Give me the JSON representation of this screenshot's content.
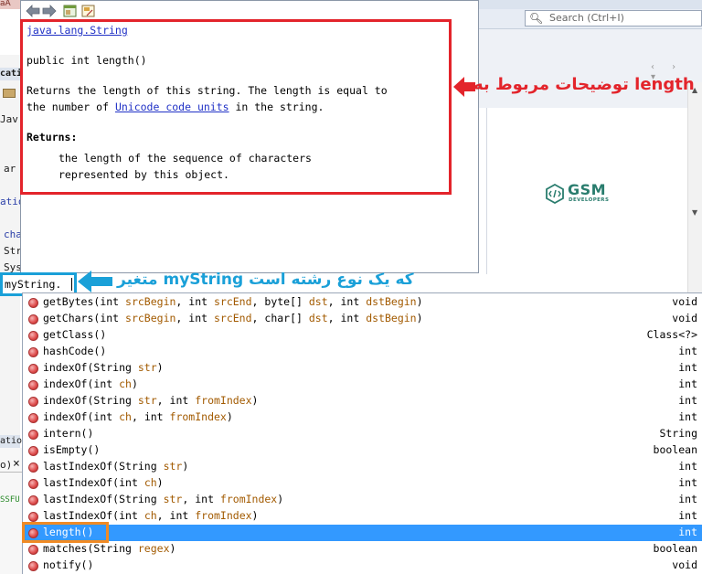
{
  "ide": {
    "title_fragment": "aA",
    "search_placeholder": "Search (Ctrl+I)",
    "left_fragments": [
      "cati",
      "Jav",
      "ar",
      "atio",
      "cha",
      "Str",
      "Sys",
      "ation",
      "o)",
      "SSFU"
    ],
    "logo_text": "GSM",
    "logo_subtext": "DEVELOPERS"
  },
  "doc_popup": {
    "class_link": "java.lang.String",
    "signature": "public int length()",
    "description_1": "Returns the length of this string. The length is equal to",
    "description_2a": "the number of ",
    "description_link": "Unicode code units",
    "description_2b": " in the string.",
    "returns_label": "Returns:",
    "returns_1": "the length of the sequence of characters",
    "returns_2": "represented by this object."
  },
  "annotations": {
    "red": "توضیحات مربوط به length",
    "blue": "متغیر myString که یک نوع رشته است"
  },
  "editor": {
    "input_text": "myString."
  },
  "completion": {
    "items": [
      {
        "name": "getBytes",
        "params": "(int srcBegin, int srcEnd, byte[] dst, int dstBegin)",
        "ret": "void",
        "selected": false
      },
      {
        "name": "getChars",
        "params": "(int srcBegin, int srcEnd, char[] dst, int dstBegin)",
        "ret": "void",
        "selected": false
      },
      {
        "name": "getClass",
        "params": "()",
        "ret": "Class<?>",
        "selected": false
      },
      {
        "name": "hashCode",
        "params": "()",
        "ret": "int",
        "selected": false
      },
      {
        "name": "indexOf",
        "params": "(String str)",
        "ret": "int",
        "selected": false
      },
      {
        "name": "indexOf",
        "params": "(int ch)",
        "ret": "int",
        "selected": false
      },
      {
        "name": "indexOf",
        "params": "(String str, int fromIndex)",
        "ret": "int",
        "selected": false
      },
      {
        "name": "indexOf",
        "params": "(int ch, int fromIndex)",
        "ret": "int",
        "selected": false
      },
      {
        "name": "intern",
        "params": "()",
        "ret": "String",
        "selected": false
      },
      {
        "name": "isEmpty",
        "params": "()",
        "ret": "boolean",
        "selected": false
      },
      {
        "name": "lastIndexOf",
        "params": "(String str)",
        "ret": "int",
        "selected": false
      },
      {
        "name": "lastIndexOf",
        "params": "(int ch)",
        "ret": "int",
        "selected": false
      },
      {
        "name": "lastIndexOf",
        "params": "(String str, int fromIndex)",
        "ret": "int",
        "selected": false
      },
      {
        "name": "lastIndexOf",
        "params": "(int ch, int fromIndex)",
        "ret": "int",
        "selected": false
      },
      {
        "name": "length",
        "params": "()",
        "ret": "int",
        "selected": true
      },
      {
        "name": "matches",
        "params": "(String regex)",
        "ret": "boolean",
        "selected": false
      },
      {
        "name": "notify",
        "params": "()",
        "ret": "void",
        "selected": false
      }
    ]
  },
  "colors": {
    "annotation_red": "#e3242b",
    "annotation_blue": "#1aa0d8",
    "selection": "#3399ff",
    "highlight_orange": "#f08a24",
    "link": "#2031c6"
  }
}
